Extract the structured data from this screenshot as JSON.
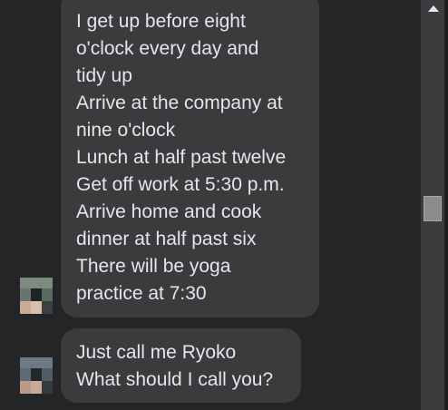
{
  "messages": [
    {
      "lines": [
        "I get up before eight",
        "o'clock every day and",
        "tidy up",
        "Arrive at the company at",
        "nine o'clock",
        "Lunch at half past twelve",
        "Get off work at 5:30 p.m.",
        "Arrive home and cook",
        "dinner at half past six",
        "There will be yoga",
        "practice at 7:30"
      ]
    },
    {
      "lines": [
        "Just call me Ryoko",
        "What should I call you?"
      ]
    }
  ],
  "colors": {
    "background": "#242526",
    "bubble": "#3a3b3c",
    "text": "#e4e6eb"
  }
}
